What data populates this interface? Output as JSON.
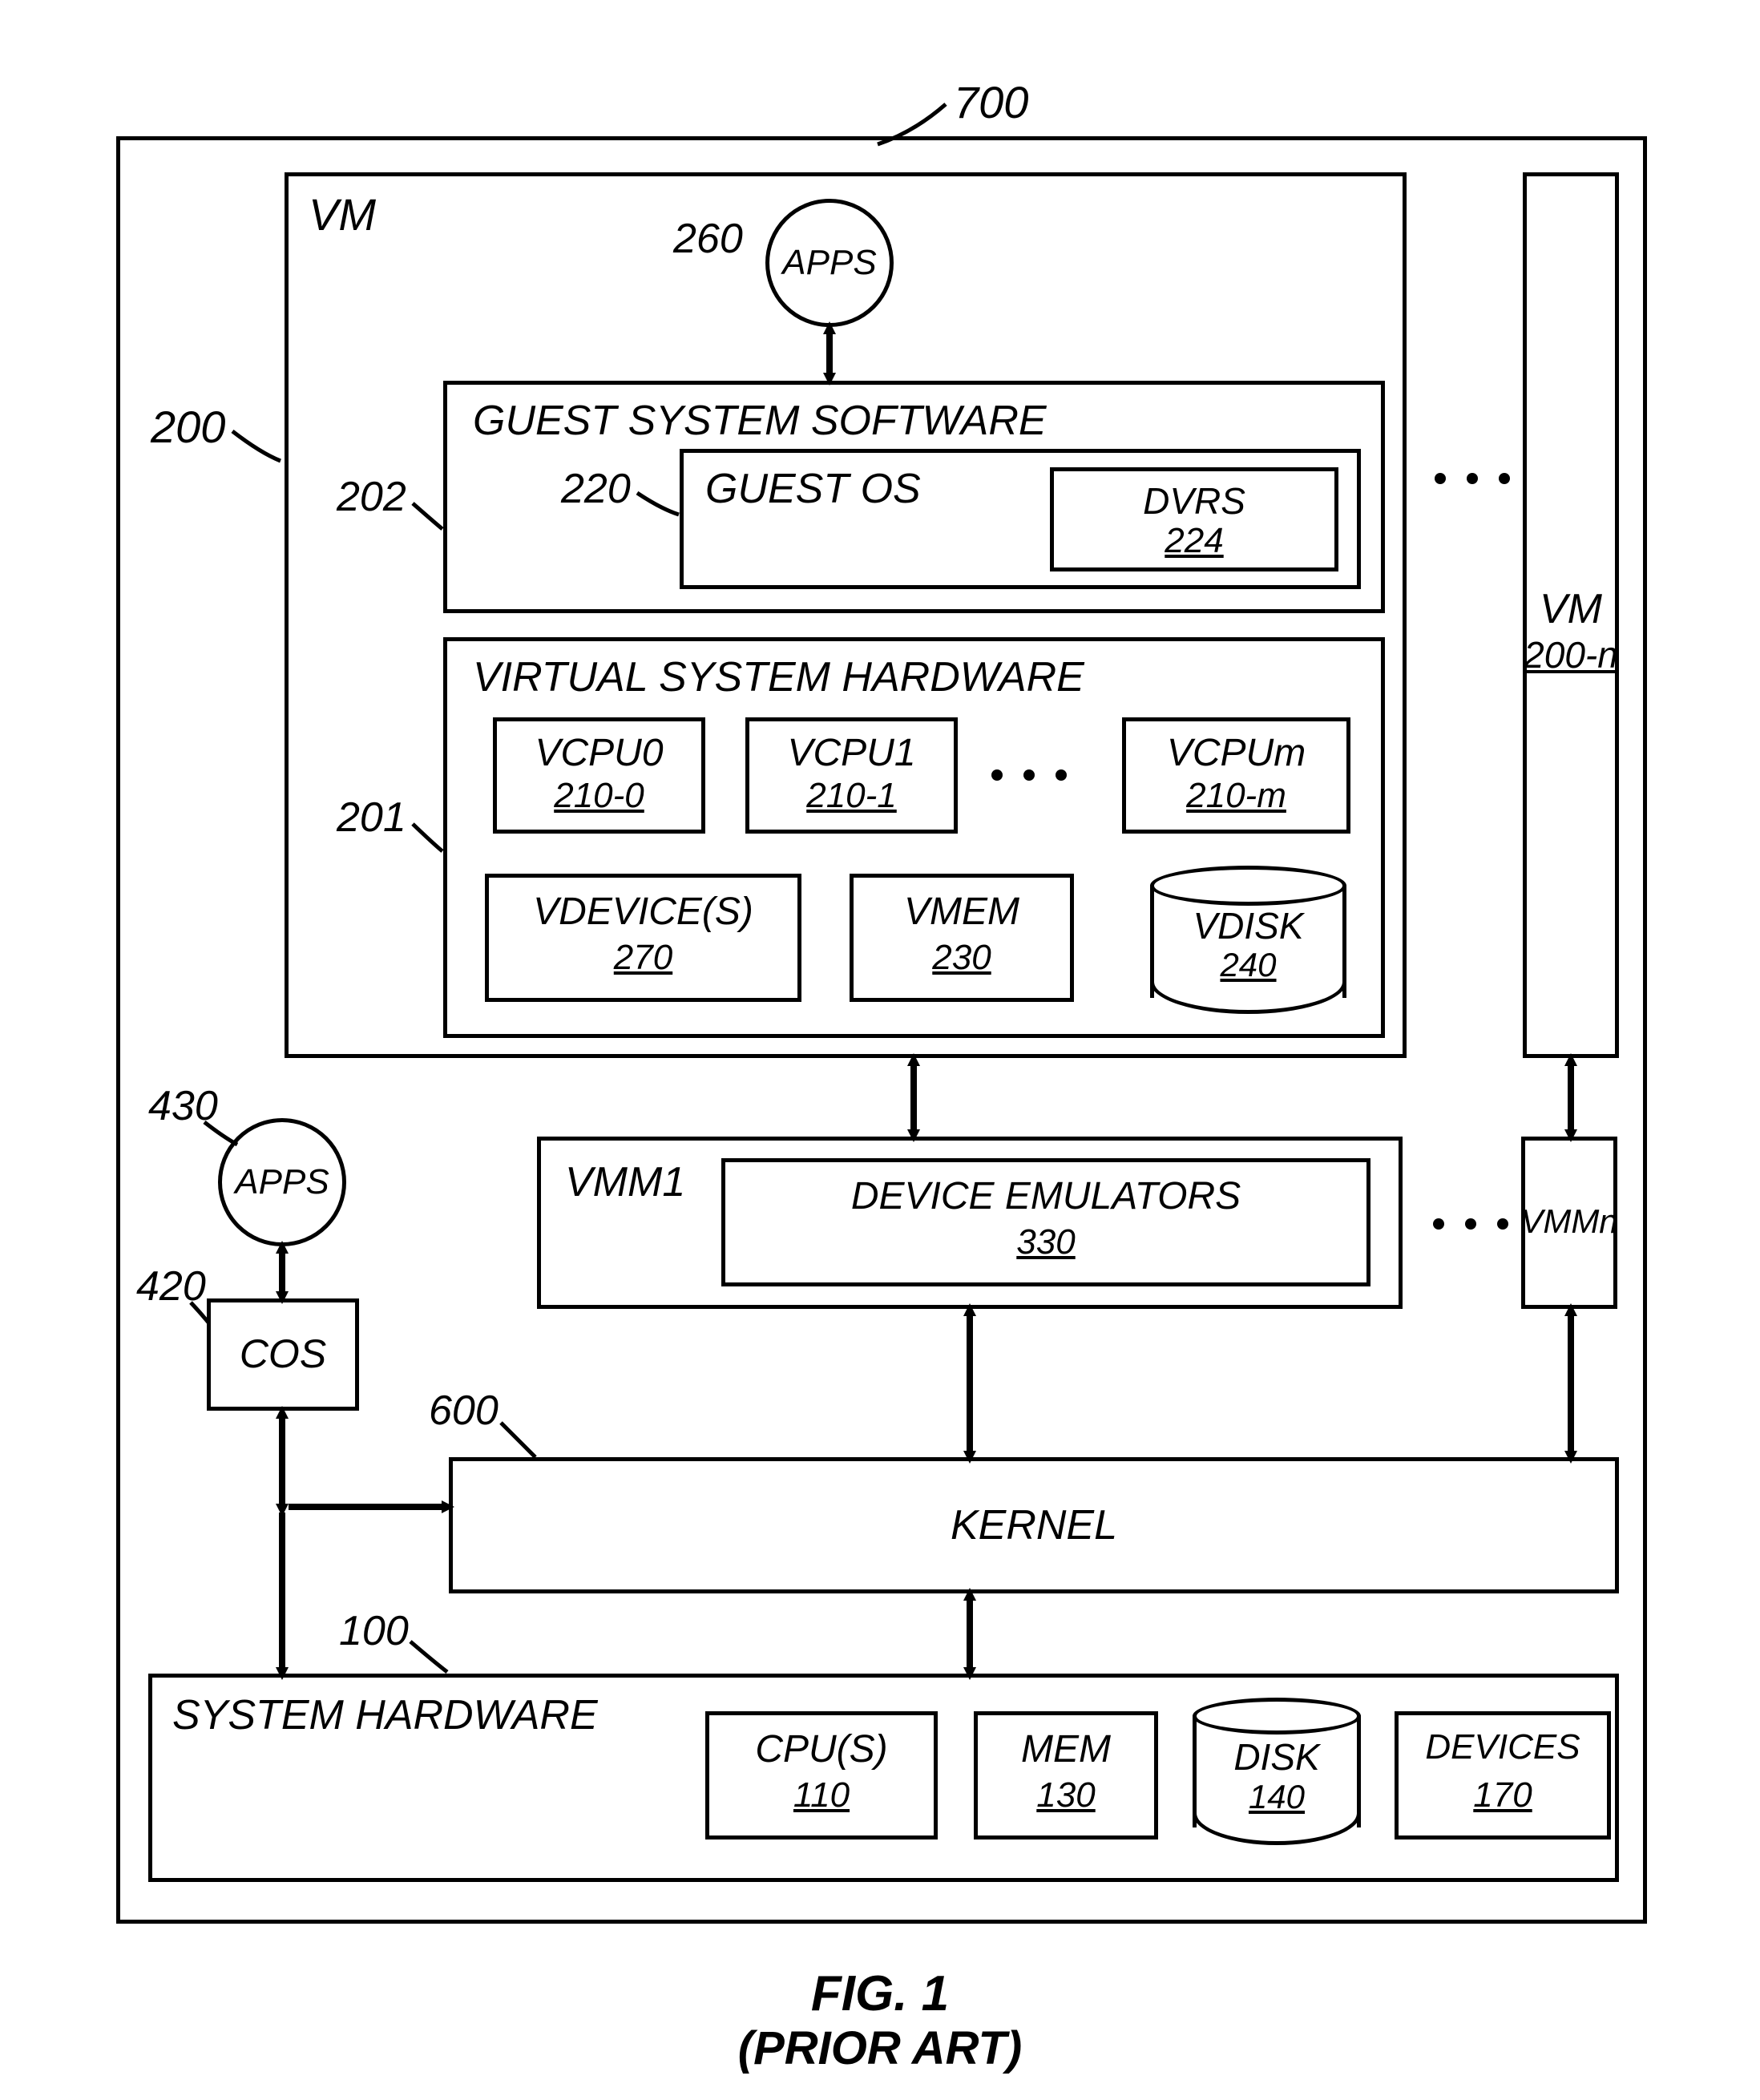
{
  "figure": {
    "title": "FIG. 1",
    "subtitle": "(PRIOR ART)"
  },
  "outer": {
    "ref": "700"
  },
  "vm": {
    "label": "VM",
    "ref": "200"
  },
  "vm_n": {
    "label": "VM",
    "ref": "200-n"
  },
  "apps_vm": {
    "label": "APPS",
    "ref": "260"
  },
  "gss": {
    "label": "GUEST SYSTEM SOFTWARE",
    "ref": "202"
  },
  "guest_os": {
    "label": "GUEST OS",
    "ref": "220"
  },
  "dvrs": {
    "label": "DVRS",
    "ref": "224"
  },
  "vsh": {
    "label": "VIRTUAL SYSTEM HARDWARE",
    "ref": "201"
  },
  "vcpu0": {
    "label": "VCPU0",
    "ref": "210-0"
  },
  "vcpu1": {
    "label": "VCPU1",
    "ref": "210-1"
  },
  "vcpum": {
    "label": "VCPUm",
    "ref": "210-m"
  },
  "vdev": {
    "label": "VDEVICE(S)",
    "ref": "270"
  },
  "vmem": {
    "label": "VMEM",
    "ref": "230"
  },
  "vdisk": {
    "label": "VDISK",
    "ref": "240"
  },
  "vmm1": {
    "label": "VMM1"
  },
  "dev_emu": {
    "label": "DEVICE EMULATORS",
    "ref": "330"
  },
  "vmmn": {
    "label": "VMMn"
  },
  "apps_cos": {
    "label": "APPS",
    "ref": "430"
  },
  "cos": {
    "label": "COS",
    "ref": "420"
  },
  "kernel": {
    "label": "KERNEL",
    "ref": "600"
  },
  "sys_hw": {
    "label": "SYSTEM HARDWARE",
    "ref": "100"
  },
  "cpu": {
    "label": "CPU(S)",
    "ref": "110"
  },
  "mem": {
    "label": "MEM",
    "ref": "130"
  },
  "disk": {
    "label": "DISK",
    "ref": "140"
  },
  "devices": {
    "label": "DEVICES",
    "ref": "170"
  }
}
